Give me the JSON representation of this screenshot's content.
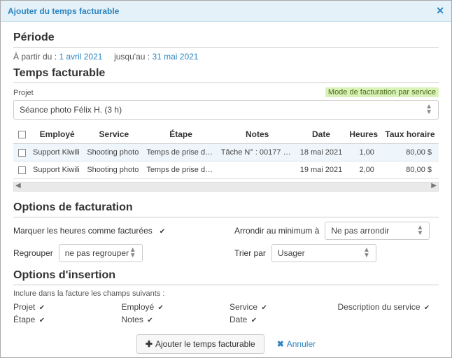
{
  "header": {
    "title": "Ajouter du temps facturable"
  },
  "period": {
    "section": "Période",
    "from_label": "À partir du :",
    "from_date": "1 avril 2021",
    "to_label": "jusqu'au :",
    "to_date": "31 mai 2021"
  },
  "billable": {
    "section": "Temps facturable",
    "project_label": "Projet",
    "mode_badge": "Mode de facturation par service",
    "project_value": "Séance photo Félix H. (3 h)",
    "columns": {
      "employee": "Employé",
      "service": "Service",
      "step": "Étape",
      "notes": "Notes",
      "date": "Date",
      "hours": "Heures",
      "rate": "Taux horaire"
    },
    "rows": [
      {
        "employee": "Support Kiwili",
        "service": "Shooting photo",
        "step": "Temps de prise d…",
        "notes": "Tâche N° : 00177 …",
        "date": "18 mai 2021",
        "hours": "1,00",
        "rate": "80,00 $"
      },
      {
        "employee": "Support Kiwili",
        "service": "Shooting photo",
        "step": "Temps de prise d…",
        "notes": "",
        "date": "19 mai 2021",
        "hours": "2,00",
        "rate": "80,00 $"
      }
    ]
  },
  "billing_opts": {
    "section": "Options de facturation",
    "mark_hours": "Marquer les heures comme facturées",
    "round_label": "Arrondir au minimum à",
    "round_value": "Ne pas arrondir",
    "group_label": "Regrouper",
    "group_value": "ne pas regrouper",
    "sort_label": "Trier par",
    "sort_value": "Usager"
  },
  "insert_opts": {
    "section": "Options d'insertion",
    "desc": "Inclure dans la facture les champs suivants :",
    "fields": {
      "project": "Projet",
      "step": "Étape",
      "employee": "Employé",
      "notes": "Notes",
      "service": "Service",
      "date": "Date",
      "service_desc": "Description du service"
    }
  },
  "footer": {
    "add": "Ajouter le temps facturable",
    "cancel": "Annuler"
  }
}
